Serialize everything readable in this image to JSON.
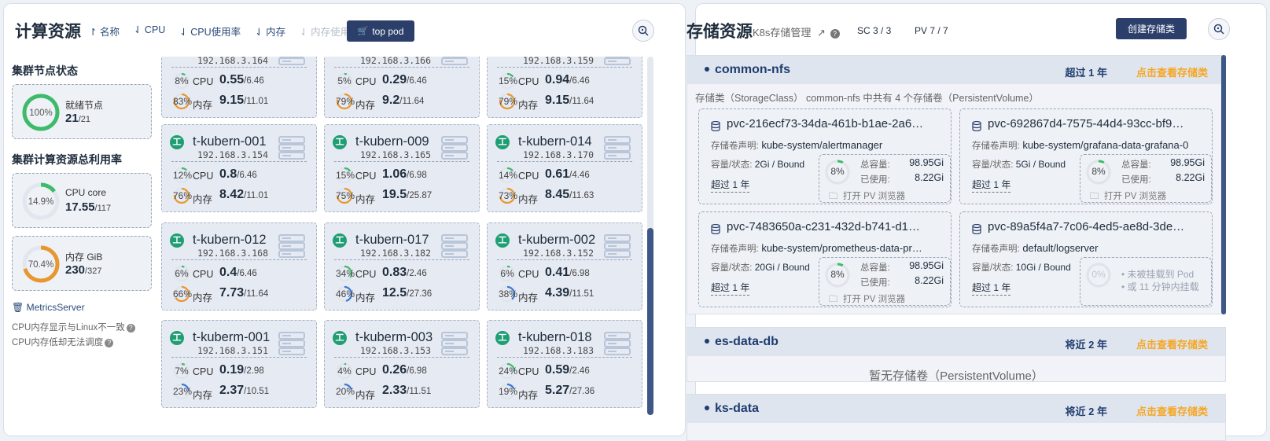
{
  "compute": {
    "title": "计算资源",
    "sort": {
      "name": "名称",
      "cpu": "CPU",
      "cpu_usage": "CPU使用率",
      "mem": "内存",
      "mem_usage": "内存使用率"
    },
    "top_pod_label": "top pod",
    "cluster_node_status_title": "集群节点状态",
    "ready_nodes": {
      "percent": "100%",
      "fraction": 1.0,
      "label": "就绪节点",
      "value": "21",
      "total": "/21"
    },
    "cluster_util_title": "集群计算资源总利用率",
    "cpu_core": {
      "percent": "14.9%",
      "fraction": 0.149,
      "label": "CPU core",
      "value": "17.55",
      "total": "/117"
    },
    "mem_gib": {
      "percent": "70.4%",
      "fraction": 0.704,
      "label": "内存 GiB",
      "value": "230",
      "total": "/327"
    },
    "metrics_server": "MetricsServer",
    "note1": "CPU内存显示与Linux不一致",
    "note2": "CPU内存低却无法调度",
    "cpu_label": "CPU",
    "mem_label": "内存",
    "nodes": [
      {
        "name": "",
        "ip": "192.168.3.164",
        "cpu_pct": "8%",
        "cpu": 0.08,
        "cpu_val": "0.55",
        "cpu_total": "/6.46",
        "mem_pct": "83%",
        "mem": 0.83,
        "mem_val": "9.15",
        "mem_total": "/11.01"
      },
      {
        "name": "",
        "ip": "192.168.3.166",
        "cpu_pct": "5%",
        "cpu": 0.05,
        "cpu_val": "0.29",
        "cpu_total": "/6.46",
        "mem_pct": "79%",
        "mem": 0.79,
        "mem_val": "9.2",
        "mem_total": "/11.64"
      },
      {
        "name": "",
        "ip": "192.168.3.159",
        "cpu_pct": "15%",
        "cpu": 0.15,
        "cpu_val": "0.94",
        "cpu_total": "/6.46",
        "mem_pct": "79%",
        "mem": 0.79,
        "mem_val": "9.15",
        "mem_total": "/11.64"
      },
      {
        "name": "t-kubern-001",
        "ip": "192.168.3.154",
        "cpu_pct": "12%",
        "cpu": 0.12,
        "cpu_val": "0.8",
        "cpu_total": "/6.46",
        "mem_pct": "76%",
        "mem": 0.76,
        "mem_val": "8.42",
        "mem_total": "/11.01"
      },
      {
        "name": "t-kubern-009",
        "ip": "192.168.3.165",
        "cpu_pct": "15%",
        "cpu": 0.15,
        "cpu_val": "1.06",
        "cpu_total": "/6.98",
        "mem_pct": "75%",
        "mem": 0.75,
        "mem_val": "19.5",
        "mem_total": "/25.87"
      },
      {
        "name": "t-kubern-014",
        "ip": "192.168.3.170",
        "cpu_pct": "14%",
        "cpu": 0.14,
        "cpu_val": "0.61",
        "cpu_total": "/4.46",
        "mem_pct": "73%",
        "mem": 0.73,
        "mem_val": "8.45",
        "mem_total": "/11.63"
      },
      {
        "name": "t-kubern-012",
        "ip": "192.168.3.168",
        "cpu_pct": "6%",
        "cpu": 0.06,
        "cpu_val": "0.4",
        "cpu_total": "/6.46",
        "mem_pct": "66%",
        "mem": 0.66,
        "mem_val": "7.73",
        "mem_total": "/11.64"
      },
      {
        "name": "t-kubern-017",
        "ip": "192.168.3.182",
        "cpu_pct": "34%",
        "cpu": 0.34,
        "cpu_val": "0.83",
        "cpu_total": "/2.46",
        "mem_pct": "46%",
        "mem": 0.46,
        "mem_val": "12.5",
        "mem_total": "/27.36"
      },
      {
        "name": "t-kuberm-002",
        "ip": "192.168.3.152",
        "cpu_pct": "6%",
        "cpu": 0.06,
        "cpu_val": "0.41",
        "cpu_total": "/6.98",
        "mem_pct": "38%",
        "mem": 0.38,
        "mem_val": "4.39",
        "mem_total": "/11.51"
      },
      {
        "name": "t-kuberm-001",
        "ip": "192.168.3.151",
        "cpu_pct": "7%",
        "cpu": 0.07,
        "cpu_val": "0.19",
        "cpu_total": "/2.98",
        "mem_pct": "23%",
        "mem": 0.23,
        "mem_val": "2.37",
        "mem_total": "/10.51"
      },
      {
        "name": "t-kuberm-003",
        "ip": "192.168.3.153",
        "cpu_pct": "4%",
        "cpu": 0.04,
        "cpu_val": "0.26",
        "cpu_total": "/6.98",
        "mem_pct": "20%",
        "mem": 0.2,
        "mem_val": "2.33",
        "mem_total": "/11.51"
      },
      {
        "name": "t-kubern-018",
        "ip": "192.168.3.183",
        "cpu_pct": "24%",
        "cpu": 0.24,
        "cpu_val": "0.59",
        "cpu_total": "/2.46",
        "mem_pct": "19%",
        "mem": 0.19,
        "mem_val": "5.27",
        "mem_total": "/27.36"
      }
    ]
  },
  "storage": {
    "title": "存储资源",
    "subtitle": "K8s存储管理",
    "sc_count": "SC 3 / 3",
    "pv_count": "PV 7 / 7",
    "create_label": "创建存储类",
    "claim_label": "存储卷声明:",
    "cap_label": "容量/状态:",
    "total_label": "总容量:",
    "used_label": "已使用:",
    "open_label": "打开 PV 浏览器",
    "groups": [
      {
        "name": "common-nfs",
        "age": "超过 1 年",
        "link": "点击查看存储类",
        "desc": "存储类（StorageClass） common-nfs 中共有 4 个存储卷（PersistentVolume）",
        "pvs": [
          {
            "name": "pvc-216ecf73-34da-461b-b1ae-2a6…",
            "claim": "kube-system/alertmanager",
            "cap": "2Gi / Bound",
            "age": "超过 1 年",
            "pct": "8%",
            "fraction": 0.08,
            "total": "98.95Gi",
            "used": "8.22Gi"
          },
          {
            "name": "pvc-692867d4-7575-44d4-93cc-bf9…",
            "claim": "kube-system/grafana-data-grafana-0",
            "cap": "5Gi / Bound",
            "age": "超过 1 年",
            "pct": "8%",
            "fraction": 0.08,
            "total": "98.95Gi",
            "used": "8.22Gi"
          },
          {
            "name": "pvc-7483650a-c231-432d-b741-d1…",
            "claim": "kube-system/prometheus-data-pr…",
            "cap": "20Gi / Bound",
            "age": "超过 1 年",
            "pct": "8%",
            "fraction": 0.08,
            "total": "98.95Gi",
            "used": "8.22Gi"
          },
          {
            "name": "pvc-89a5f4a7-7c06-4ed5-ae8d-3de…",
            "claim": "default/logserver",
            "cap": "10Gi / Bound",
            "age": "超过 1 年",
            "pct": "0%",
            "fraction": 0,
            "unmounted1": "未被挂载到 Pod",
            "unmounted2": "或 11 分钟内挂载"
          }
        ]
      },
      {
        "name": "es-data-db",
        "age": "将近 2 年",
        "link": "点击查看存储类",
        "empty": "暂无存储卷（PersistentVolume）"
      },
      {
        "name": "ks-data",
        "age": "将近 2 年",
        "link": "点击查看存储类"
      }
    ]
  },
  "colors": {
    "primary": "#2c3f6b",
    "green": "#3dbb6a",
    "orange": "#e8972f",
    "blue": "#3a78d8",
    "link": "#f5a623"
  }
}
